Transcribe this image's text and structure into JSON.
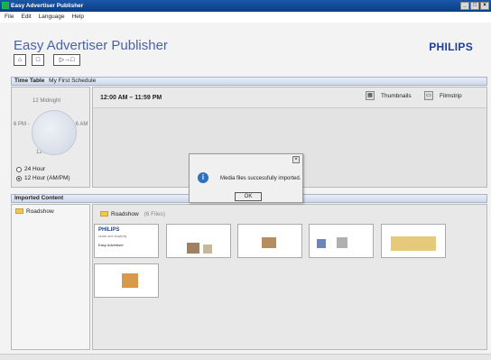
{
  "window": {
    "title": "Easy Advertiser Publisher",
    "min": "_",
    "max": "□",
    "close": "×"
  },
  "menu": [
    "File",
    "Edit",
    "Language",
    "Help"
  ],
  "header": {
    "app_name": "Easy Advertiser Publisher",
    "brand": "PHILIPS"
  },
  "toolbar": {
    "open": "⌂",
    "new": "□",
    "transfer": "▷→□"
  },
  "timetable": {
    "title": "Time Table",
    "schedule": "My First Schedule",
    "range": "12:00 AM – 11:59 PM",
    "clock": {
      "top": "12 Midnight",
      "left": "6 PM -",
      "right": "- 6 AM",
      "bottom": "12 Noon"
    },
    "options": {
      "h24": "24 Hour",
      "h12": "12 Hour (AM/PM)",
      "selected": "12 Hour (AM/PM)"
    },
    "views": {
      "thumbnails": "Thumbnails",
      "filmstrip": "Filmstrip"
    }
  },
  "imported": {
    "title": "Imported Content",
    "tree_item": "Roadshow",
    "folder": "Roadshow",
    "count": "(6 Files)",
    "first_slide": {
      "brand": "PHILIPS",
      "line": "sense and simplicity",
      "title": "Easy Advertiser"
    }
  },
  "dialog": {
    "message": "Media files successfully imported.",
    "ok": "OK",
    "close": "×",
    "icon": "i"
  },
  "icons": {
    "info": "info-icon",
    "folder": "folder-icon",
    "open": "open-folder-icon",
    "new": "new-file-icon",
    "transfer": "transfer-icon"
  },
  "colors": {
    "title_blue": "#4a62a8",
    "brand_blue": "#1c3e9c",
    "titlebar": "#0a3d84"
  }
}
